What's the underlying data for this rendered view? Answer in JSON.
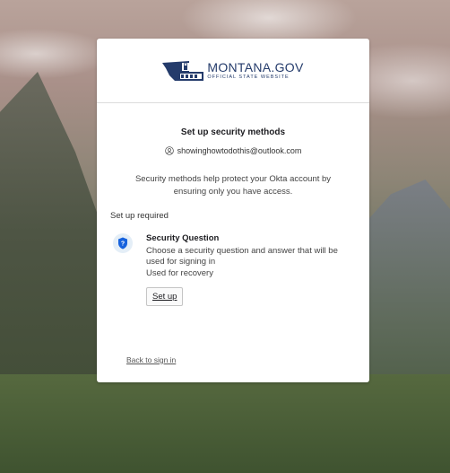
{
  "logo": {
    "main": "MONTANA.GOV",
    "sub": "OFFICIAL STATE WEBSITE"
  },
  "page": {
    "title": "Set up security methods",
    "email": "showinghowtodothis@outlook.com",
    "description": "Security methods help protect your Okta account by ensuring only you have access.",
    "section_label": "Set up required"
  },
  "method": {
    "name": "Security Question",
    "description": "Choose a security question and answer that will be used for signing in",
    "usage": "Used for recovery",
    "button_label": "Set up",
    "icon": "shield-question-icon"
  },
  "footer": {
    "back_label": "Back to sign in"
  },
  "colors": {
    "brand": "#243b6b",
    "badge_bg": "#e4eef7",
    "shield": "#1662dd"
  }
}
